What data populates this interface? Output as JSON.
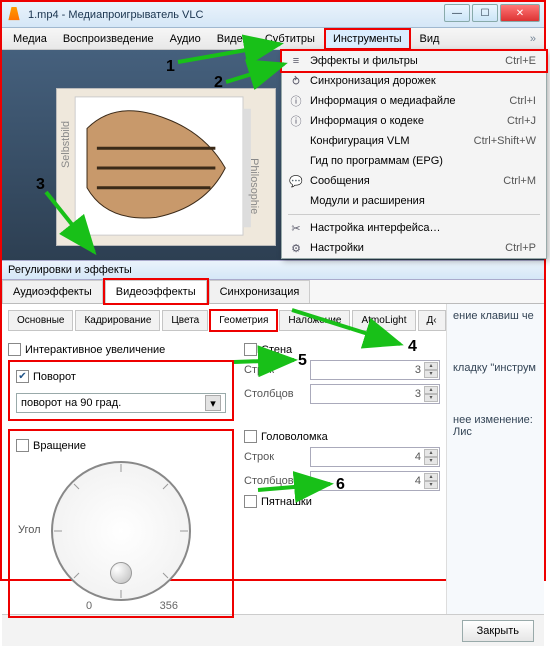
{
  "window": {
    "title": "1.mp4 - Медиапроигрыватель VLC"
  },
  "menubar": [
    "Медиа",
    "Воспроизведение",
    "Аудио",
    "Видео",
    "Субтитры",
    "Инструменты",
    "Вид"
  ],
  "dropdown": [
    {
      "icon": "equalizer-icon",
      "label": "Эффекты и фильтры",
      "shortcut": "Ctrl+E",
      "boxed": true
    },
    {
      "icon": "sync-icon",
      "label": "Синхронизация дорожек",
      "shortcut": ""
    },
    {
      "icon": "info-icon",
      "label": "Информация о медиафайле",
      "shortcut": "Ctrl+I"
    },
    {
      "icon": "info-icon",
      "label": "Информация о кодеке",
      "shortcut": "Ctrl+J"
    },
    {
      "icon": "",
      "label": "Конфигурация VLM",
      "shortcut": "Ctrl+Shift+W"
    },
    {
      "icon": "",
      "label": "Гид по программам (EPG)",
      "shortcut": ""
    },
    {
      "icon": "speech-icon",
      "label": "Сообщения",
      "shortcut": "Ctrl+M"
    },
    {
      "icon": "",
      "label": "Модули и расширения",
      "shortcut": ""
    },
    {
      "sep": true
    },
    {
      "icon": "tools-icon",
      "label": "Настройка интерфейса…",
      "shortcut": ""
    },
    {
      "icon": "gear-icon",
      "label": "Настройки",
      "shortcut": "Ctrl+P"
    }
  ],
  "dialog": {
    "title": "Регулировки и эффекты",
    "tabs_main": [
      "Аудиоэффекты",
      "Видеоэффекты",
      "Синхронизация"
    ],
    "tabs_main_active": 1,
    "tabs_sub": [
      "Основные",
      "Кадрирование",
      "Цвета",
      "Геометрия",
      "Наложение",
      "AtmoLight",
      "Д‹"
    ],
    "tabs_sub_active": 3,
    "interactive_zoom": "Интерактивное увеличение",
    "wall": "Стена",
    "rotate": {
      "label": "Поворот",
      "checked": true,
      "combo": "поворот на 90 град."
    },
    "rows_label": "Строк",
    "cols_label": "Столбцов",
    "rotation": {
      "label": "Вращение",
      "angle_label": "Угол",
      "min": "0",
      "max": "356"
    },
    "puzzle": "Головоломка",
    "fifteen": "Пятнашки",
    "spin_vals": {
      "wall_rows": "3",
      "wall_cols": "3",
      "puz_rows": "4",
      "puz_cols": "4"
    },
    "close_btn": "Закрыть"
  },
  "right_strip": {
    "line1": "ение клавиш че",
    "line2": "кладку \"инструм",
    "line3": "нее изменение: Лис"
  },
  "callouts": {
    "c1": "1",
    "c2": "2",
    "c3": "3",
    "c4": "4",
    "c5": "5",
    "c6": "6"
  }
}
